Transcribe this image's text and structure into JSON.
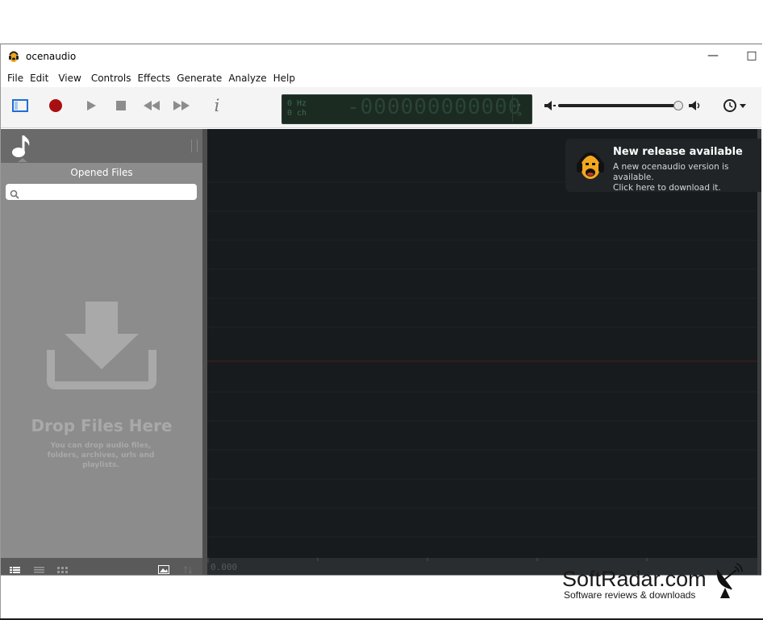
{
  "window": {
    "title": "ocenaudio",
    "minimize_glyph": "—",
    "maximize_glyph": "□"
  },
  "menu": [
    "File",
    "Edit",
    "View",
    "Controls",
    "Effects",
    "Generate",
    "Analyze",
    "Help"
  ],
  "toolbar": {
    "icons": [
      "sidebar-toggle-icon",
      "record-icon",
      "play-icon",
      "stop-icon",
      "rewind-icon",
      "fast-forward-icon",
      "info-icon",
      "volume-low-icon",
      "volume-high-icon",
      "clock-icon"
    ],
    "info_glyph": "i",
    "record_color": "#b01010",
    "accent_color": "#1f6fd6"
  },
  "display": {
    "rate": "0 Hz",
    "channels": "0 ch",
    "time": "-000000000000"
  },
  "volume": {
    "level": 0.98
  },
  "sidebar": {
    "title": "Opened Files",
    "search_placeholder": "",
    "drop_title": "Drop Files Here",
    "drop_subtitle": "You can drop audio files, folders, archives, urls and playlists."
  },
  "timeline": {
    "start": "0.000"
  },
  "notification": {
    "title": "New release available",
    "line1": "A new ocenaudio version is available.",
    "line2": "Click here to download it."
  },
  "watermark": {
    "brand": "SoftRadar.com",
    "tagline": "Software reviews & downloads"
  }
}
